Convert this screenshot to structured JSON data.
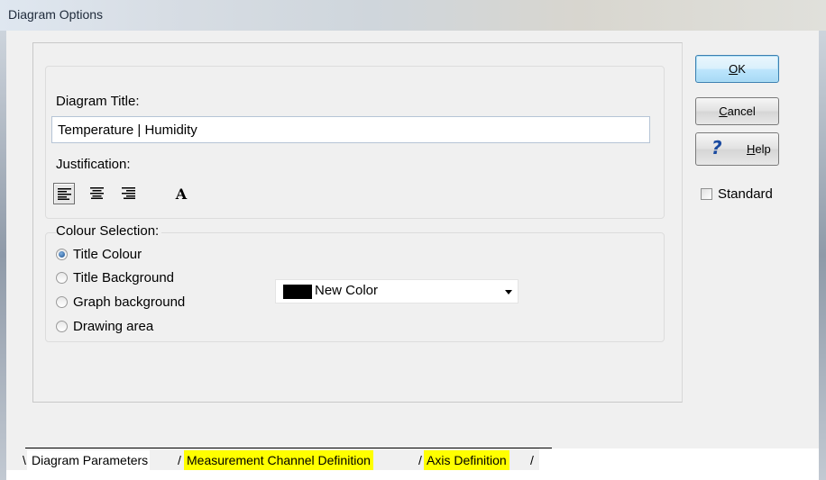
{
  "window": {
    "title": "Diagram Options"
  },
  "diagram_title": {
    "label": "Diagram Title:",
    "value": "Temperature | Humidity"
  },
  "justification": {
    "label": "Justification:",
    "options": [
      {
        "name": "align-left",
        "selected": true
      },
      {
        "name": "align-center",
        "selected": false
      },
      {
        "name": "align-right",
        "selected": false
      }
    ],
    "font_button_glyph": "A"
  },
  "colour_selection": {
    "label": "Colour Selection:",
    "options": [
      {
        "label": "Title Colour",
        "checked": true
      },
      {
        "label": "Title Background",
        "checked": false
      },
      {
        "label": "Graph background",
        "checked": false
      },
      {
        "label": "Drawing area",
        "checked": false
      }
    ],
    "color_dropdown": {
      "value": "New Color",
      "swatch_color": "#000000"
    }
  },
  "buttons": {
    "ok": "OK",
    "cancel": "Cancel",
    "help": "Help"
  },
  "standard_checkbox": {
    "label": "Standard",
    "checked": false
  },
  "tabs": [
    {
      "label": "Diagram Parameters",
      "active": true
    },
    {
      "label": "Measurement Channel Definition",
      "active": false
    },
    {
      "label": "Axis Definition",
      "active": false
    }
  ]
}
